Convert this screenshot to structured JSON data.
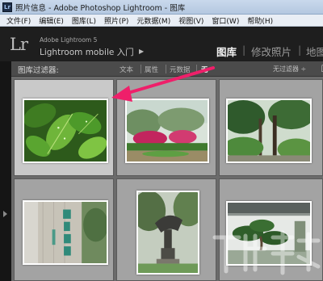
{
  "window": {
    "title": "照片信息 - Adobe Photoshop Lightroom - 图库",
    "icon_text": "Lr"
  },
  "menu": {
    "items": [
      "文件(F)",
      "编辑(E)",
      "图库(L)",
      "照片(P)",
      "元数据(M)",
      "视图(V)",
      "窗口(W)",
      "帮助(H)"
    ]
  },
  "identity": {
    "logo": "Lr",
    "product": "Adobe Lightroom 5",
    "mobile": "Lightroom mobile 入门",
    "mobile_arrow": "▶"
  },
  "modules": {
    "active": "图库",
    "develop": "修改照片",
    "map": "地图",
    "separator": "|"
  },
  "filter_bar": {
    "label": "图库过滤器:",
    "buttons": [
      "文本",
      "属性",
      "元数据",
      "无"
    ],
    "active_button": "无",
    "preset": "无过滤器 ÷"
  },
  "grid": {
    "rows": 2,
    "cols": 3,
    "selected_index": 0,
    "photos": [
      {
        "name": "green-leaves-photo",
        "scene": "leaves"
      },
      {
        "name": "garden-flowers-photo",
        "scene": "garden"
      },
      {
        "name": "trees-path-photo",
        "scene": "trees"
      },
      {
        "name": "calligraphy-stone-photo",
        "scene": "stone"
      },
      {
        "name": "statue-photo",
        "scene": "statue"
      },
      {
        "name": "bonsai-wall-photo",
        "scene": "bonsai"
      }
    ]
  },
  "colors": {
    "annotation_arrow": "#ef1f6a"
  }
}
